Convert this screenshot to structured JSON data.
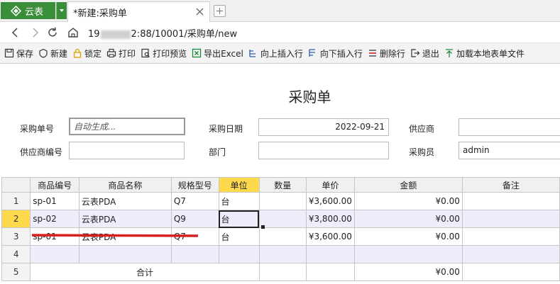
{
  "app": {
    "name": "云表"
  },
  "tab": {
    "title": "*新建:采购单"
  },
  "address": {
    "url_prefix": "19",
    "url_suffix": "2:88/10001/采购单/new"
  },
  "toolbar": {
    "save": "保存",
    "new": "新建",
    "lock": "锁定",
    "print": "打印",
    "preview": "打印预览",
    "excel": "导出Excel",
    "insert_up": "向上插入行",
    "insert_down": "向下插入行",
    "delete_row": "删除行",
    "exit": "退出",
    "load_local": "加载本地表单文件"
  },
  "form": {
    "title": "采购单",
    "order_no_label": "采购单号",
    "order_no_value": "自动生成...",
    "date_label": "采购日期",
    "date_value": "2022-09-21",
    "supplier_label": "供应商",
    "supplier_value": "",
    "supplier_code_label": "供应商编号",
    "supplier_code_value": "",
    "dept_label": "部门",
    "dept_value": "",
    "buyer_label": "采购员",
    "buyer_value": "admin"
  },
  "grid": {
    "headers": [
      "商品编号",
      "商品名称",
      "规格型号",
      "单位",
      "数量",
      "单价",
      "金额",
      "备注"
    ],
    "rows": [
      {
        "num": "1",
        "code": "sp-01",
        "name": "云表PDA",
        "spec": "Q7",
        "unit": "台",
        "qty": "",
        "price": "¥3,600.00",
        "amount": "¥0.00",
        "note": ""
      },
      {
        "num": "2",
        "code": "sp-02",
        "name": "云表PDA",
        "spec": "Q9",
        "unit": "台",
        "qty": "",
        "price": "¥3,800.00",
        "amount": "¥0.00",
        "note": ""
      },
      {
        "num": "3",
        "code": "sp-01",
        "name": "云表PDA",
        "spec": "Q7",
        "unit": "台",
        "qty": "",
        "price": "¥3,600.00",
        "amount": "¥0.00",
        "note": ""
      },
      {
        "num": "4",
        "code": "",
        "name": "",
        "spec": "",
        "unit": "",
        "qty": "",
        "price": "",
        "amount": "",
        "note": ""
      }
    ],
    "total": {
      "num": "5",
      "label": "合计",
      "amount": "¥0.00"
    }
  },
  "colors": {
    "brand": "#3a8e3a",
    "highlight": "#ffd94c",
    "row_alt": "#ededfb",
    "strike": "#d62020"
  }
}
